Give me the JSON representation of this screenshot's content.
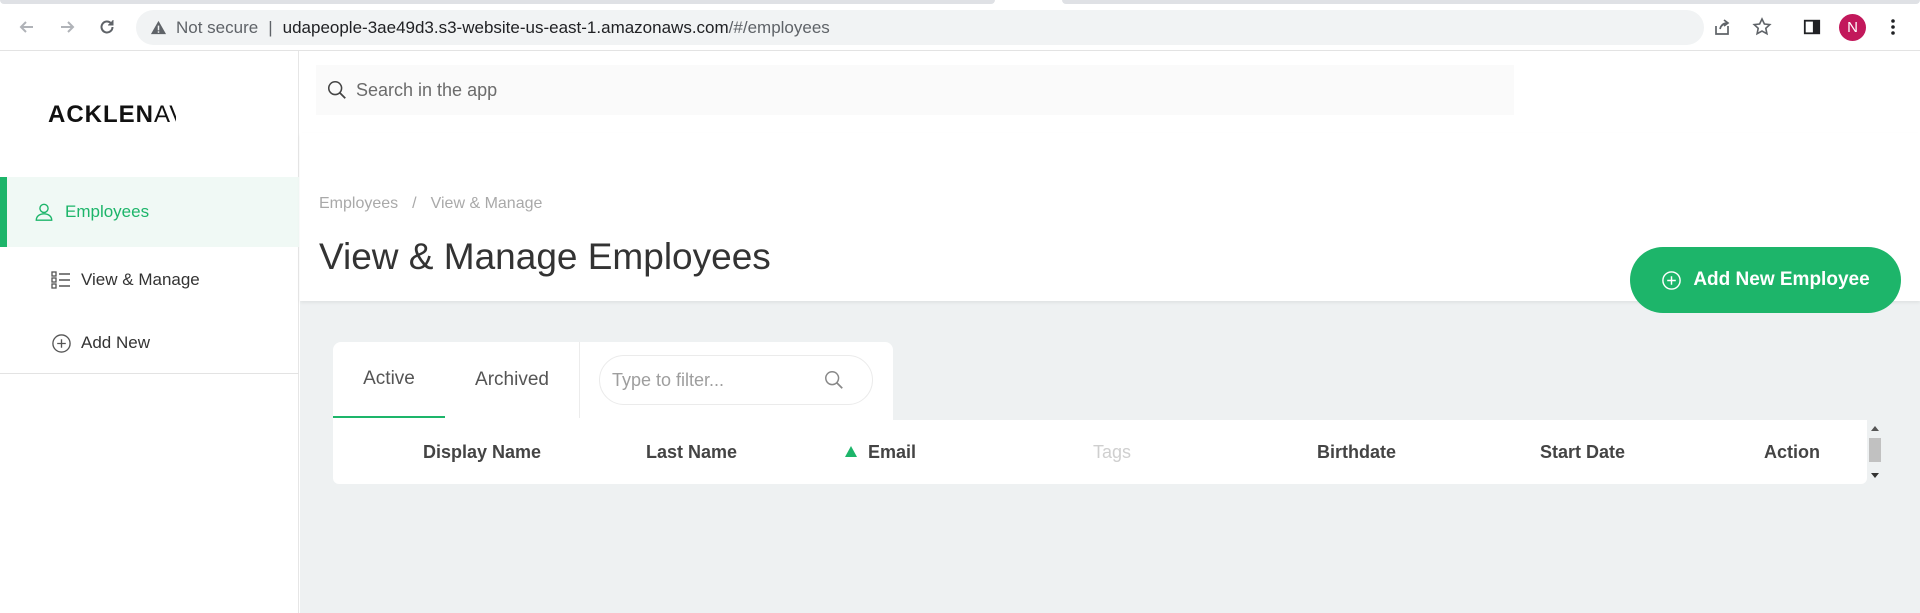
{
  "browser": {
    "not_secure_label": "Not secure",
    "url_host": "udapeople-3ae49d3.s3-website-us-east-1.amazonaws.com",
    "url_path": "/#/employees",
    "profile_initial": "N"
  },
  "brand": {
    "logo_bold": "ACKLEN",
    "logo_thin": "AV"
  },
  "sidebar": {
    "items": [
      {
        "label": "Employees",
        "icon": "user-icon",
        "active": true
      },
      {
        "label": "View & Manage",
        "icon": "list-icon",
        "active": false
      },
      {
        "label": "Add New",
        "icon": "plus-circle-icon",
        "active": false
      }
    ]
  },
  "search": {
    "placeholder": "Search in the app"
  },
  "header": {
    "breadcrumb": [
      "Employees",
      "/",
      "View & Manage"
    ],
    "title": "View & Manage Employees",
    "add_button_label": "Add New Employee"
  },
  "tabs": [
    {
      "label": "Active",
      "active": true
    },
    {
      "label": "Archived",
      "active": false
    }
  ],
  "filter": {
    "placeholder": "Type to filter..."
  },
  "table": {
    "columns": [
      {
        "label": "Display Name"
      },
      {
        "label": "Last Name"
      },
      {
        "label": "Email",
        "sorted": "asc"
      },
      {
        "label": "Tags",
        "muted": true
      },
      {
        "label": "Birthdate"
      },
      {
        "label": "Start Date"
      },
      {
        "label": "Action"
      }
    ]
  },
  "colors": {
    "accent": "#1db56a",
    "profile": "#c2185b"
  }
}
